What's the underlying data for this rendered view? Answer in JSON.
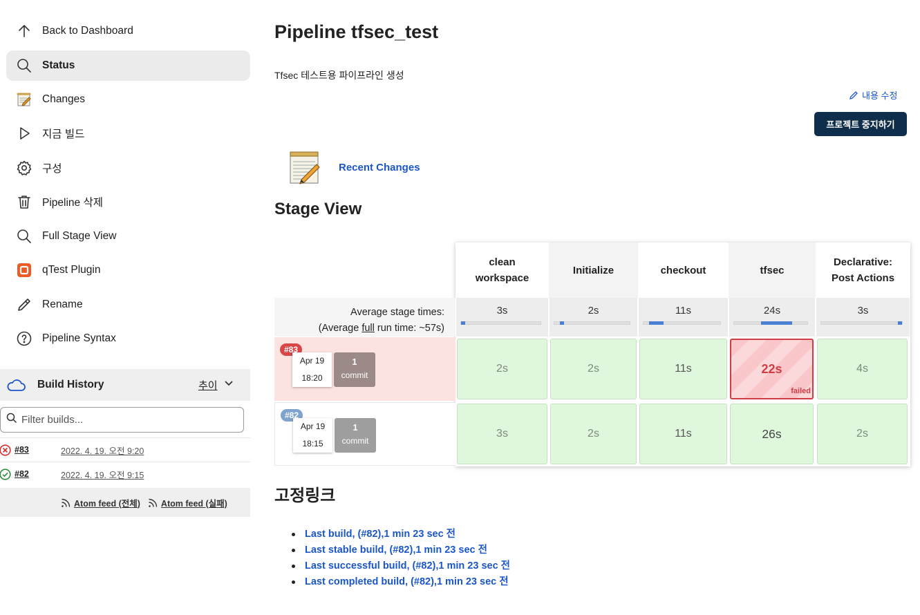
{
  "sidebar": {
    "items": [
      {
        "label": "Back to Dashboard",
        "icon": "arrow-up-icon"
      },
      {
        "label": "Status",
        "icon": "search-icon",
        "active": true
      },
      {
        "label": "Changes",
        "icon": "notepad-icon"
      },
      {
        "label": "지금 빌드",
        "icon": "play-icon"
      },
      {
        "label": "구성",
        "icon": "gear-icon"
      },
      {
        "label": "Pipeline 삭제",
        "icon": "trash-icon"
      },
      {
        "label": "Full Stage View",
        "icon": "search-icon"
      },
      {
        "label": "qTest Plugin",
        "icon": "qtest-icon"
      },
      {
        "label": "Rename",
        "icon": "pencil-icon"
      },
      {
        "label": "Pipeline Syntax",
        "icon": "help-icon"
      }
    ]
  },
  "build_history": {
    "title": "Build History",
    "trend_label": "추이",
    "filter_placeholder": "Filter builds...",
    "builds": [
      {
        "number": "#83",
        "date": "2022. 4. 19. 오전 9:20",
        "status": "failed"
      },
      {
        "number": "#82",
        "date": "2022. 4. 19. 오전 9:15",
        "status": "success"
      }
    ],
    "feed_all": "Atom feed (전체)",
    "feed_failed": "Atom feed (실패)"
  },
  "main": {
    "title": "Pipeline tfsec_test",
    "description": "Tfsec 테스트용 파이프라인 생성",
    "edit_description": "내용 수정",
    "disable_button": "프로젝트 중지하기",
    "recent_changes": "Recent Changes",
    "stage_view_title": "Stage View"
  },
  "stage_view": {
    "avg_label_line1": "Average stage times:",
    "avg_label_prefix": "(Average ",
    "avg_label_full": "full",
    "avg_label_suffix": " run time: ~57s)",
    "stages": [
      {
        "line1": "clean",
        "line2": "workspace",
        "avg": "3s",
        "fill_fraction": 0.05
      },
      {
        "line1": "Initialize",
        "line2": "",
        "avg": "2s",
        "fill_fraction": 0.04
      },
      {
        "line1": "checkout",
        "line2": "",
        "avg": "11s",
        "fill_fraction": 0.19
      },
      {
        "line1": "tfsec",
        "line2": "",
        "avg": "24s",
        "fill_fraction": 0.42
      },
      {
        "line1": "Declarative:",
        "line2": "Post Actions",
        "avg": "3s",
        "fill_fraction": 0.05
      }
    ],
    "builds": [
      {
        "number": "#83",
        "month_day": "Apr 19",
        "time": "18:20",
        "commits": "1",
        "commit_label": "commit",
        "durations": [
          "2s",
          "2s",
          "11s",
          "22s",
          "4s"
        ],
        "failed_stage_tag": "failed"
      },
      {
        "number": "#82",
        "month_day": "Apr 19",
        "time": "18:15",
        "commits": "1",
        "commit_label": "commit",
        "durations": [
          "3s",
          "2s",
          "11s",
          "26s",
          "2s"
        ]
      }
    ]
  },
  "permalinks": {
    "title": "고정링크",
    "links": [
      "Last build, (#82),1 min 23 sec 전",
      "Last stable build, (#82),1 min 23 sec 전",
      "Last successful build, (#82),1 min 23 sec 전",
      "Last completed build, (#82),1 min 23 sec 전"
    ]
  },
  "colors": {
    "link": "#1a56c8",
    "failed": "#d03d45",
    "success_cell": "#dff7dc",
    "primary_button": "#0e2e4b"
  }
}
